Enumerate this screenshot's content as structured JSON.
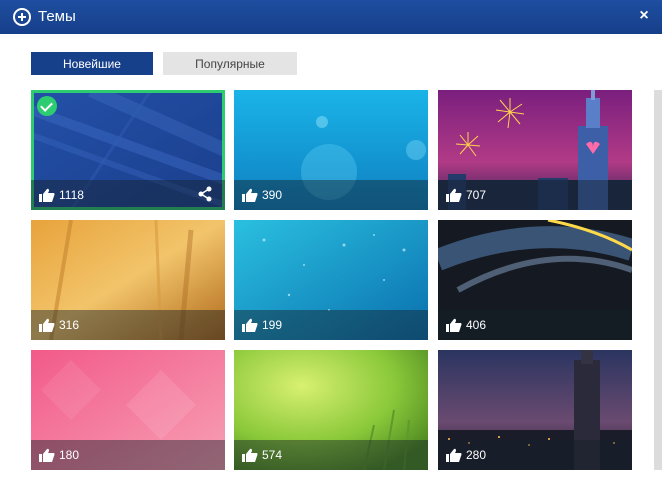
{
  "window": {
    "title": "Темы",
    "close_label": "×"
  },
  "tabs": [
    {
      "label": "Новейшие",
      "active": true
    },
    {
      "label": "Популярные",
      "active": false
    }
  ],
  "themes": [
    {
      "likes": "1118",
      "selected": true
    },
    {
      "likes": "390"
    },
    {
      "likes": "707"
    },
    {
      "likes": "316"
    },
    {
      "likes": "199"
    },
    {
      "likes": "406"
    },
    {
      "likes": "180"
    },
    {
      "likes": "574"
    },
    {
      "likes": "280"
    }
  ],
  "colors": {
    "accent": "#17408a",
    "selected": "#2ecc71"
  }
}
